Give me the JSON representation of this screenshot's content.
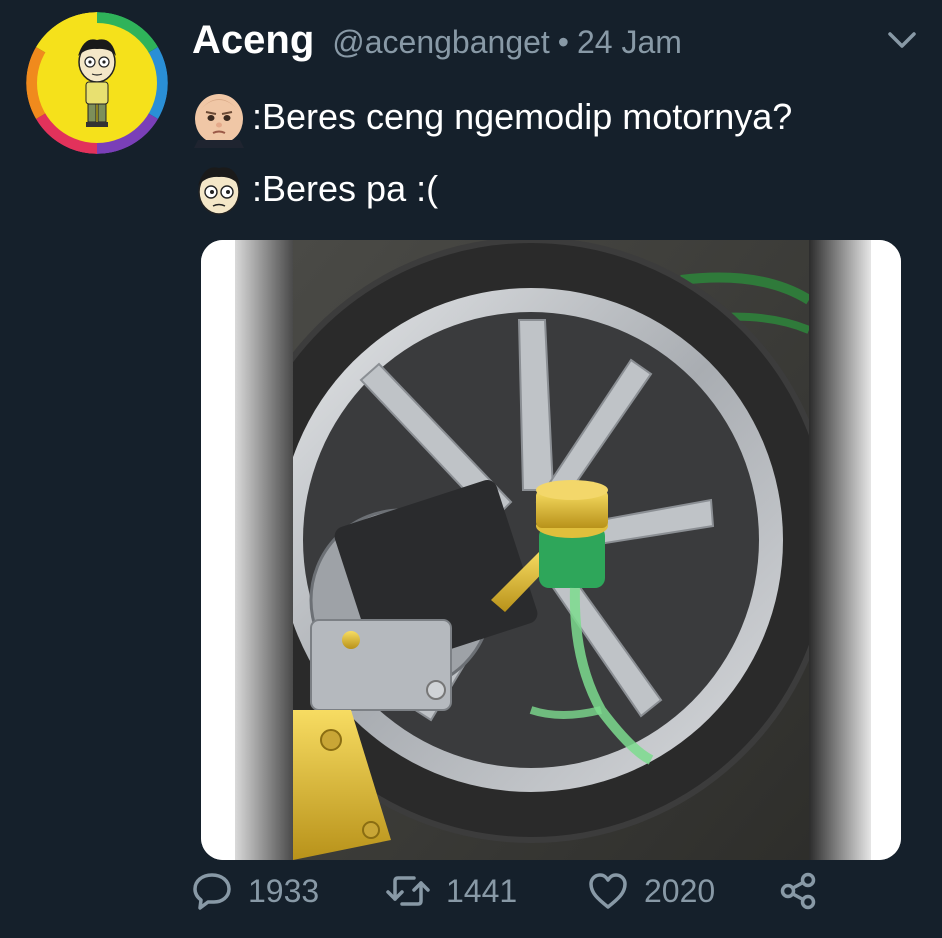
{
  "tweet": {
    "display_name": "Aceng",
    "handle": "@acengbanget",
    "separator": "•",
    "time": "24 Jam",
    "lines": [
      {
        "speaker_icon": "baby-face-icon",
        "text": ":Beres ceng ngemodip motornya?"
      },
      {
        "speaker_icon": "cartoon-face-icon",
        "text": ":Beres pa :("
      }
    ],
    "media": {
      "subject_icon": "motorcycle-wheel-photo"
    },
    "actions": {
      "replies": "1933",
      "retweets": "1441",
      "likes": "2020"
    },
    "icons": {
      "menu": "chevron-down-icon",
      "reply": "reply-icon",
      "retweet": "retweet-icon",
      "like": "heart-icon",
      "share": "share-icon"
    }
  },
  "colors": {
    "background": "#15202b",
    "text_primary": "#ffffff",
    "text_secondary": "#8899a6",
    "brand_yellow": "#f5e11b"
  }
}
